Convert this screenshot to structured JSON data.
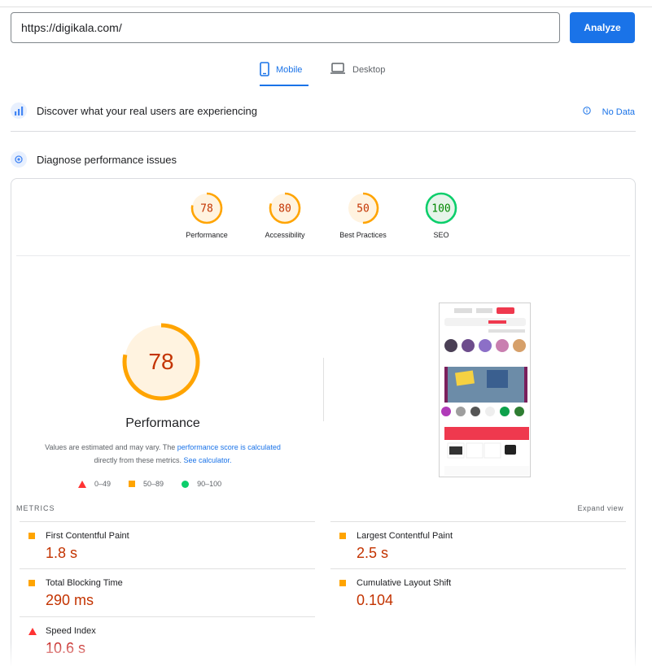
{
  "search": {
    "url": "https://digikala.com/",
    "analyze_label": "Analyze"
  },
  "tabs": [
    {
      "label": "Mobile",
      "active": true,
      "icon": "phone-icon"
    },
    {
      "label": "Desktop",
      "active": false,
      "icon": "laptop-icon"
    }
  ],
  "field_data": {
    "title": "Discover what your real users are experiencing",
    "status": "No Data"
  },
  "diagnose": {
    "title": "Diagnose performance issues"
  },
  "categories": [
    {
      "label": "Performance",
      "score": "78",
      "fraction": 0.78,
      "color": "#ffa400"
    },
    {
      "label": "Accessibility",
      "score": "80",
      "fraction": 0.8,
      "color": "#ffa400"
    },
    {
      "label": "Best Practices",
      "score": "50",
      "fraction": 0.5,
      "color": "#ffa400"
    },
    {
      "label": "SEO",
      "score": "100",
      "fraction": 1.0,
      "color": "#0cce6b"
    }
  ],
  "main_gauge": {
    "score": "78",
    "fraction": 0.78,
    "title": "Performance"
  },
  "description": {
    "prefix": "Values are estimated and may vary. The ",
    "link1": "performance score is calculated",
    "middle": " directly from these metrics. ",
    "link2": "See calculator."
  },
  "legend": [
    {
      "shape": "triangle",
      "range": "0–49",
      "color": "#ff3333"
    },
    {
      "shape": "square",
      "range": "50–89",
      "color": "#ffa400"
    },
    {
      "shape": "circle",
      "range": "90–100",
      "color": "#0cce6b"
    }
  ],
  "metrics_header": "METRICS",
  "expand_label": "Expand view",
  "metrics": [
    {
      "name": "First Contentful Paint",
      "value": "1.8 s",
      "rating": "average"
    },
    {
      "name": "Largest Contentful Paint",
      "value": "2.5 s",
      "rating": "average"
    },
    {
      "name": "Total Blocking Time",
      "value": "290 ms",
      "rating": "average"
    },
    {
      "name": "Cumulative Layout Shift",
      "value": "0.104",
      "rating": "average"
    },
    {
      "name": "Speed Index",
      "value": "10.6 s",
      "rating": "poor"
    }
  ]
}
